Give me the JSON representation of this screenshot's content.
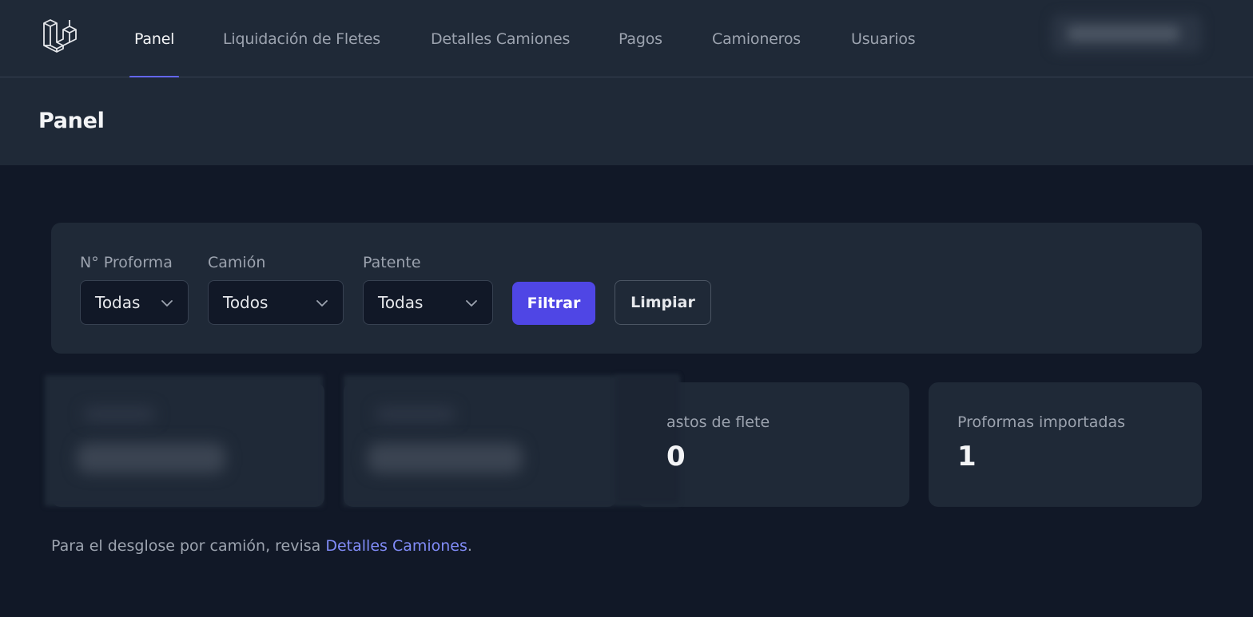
{
  "nav": {
    "items": [
      {
        "label": "Panel",
        "active": true
      },
      {
        "label": "Liquidación de Fletes",
        "active": false
      },
      {
        "label": "Detalles Camiones",
        "active": false
      },
      {
        "label": "Pagos",
        "active": false
      },
      {
        "label": "Camioneros",
        "active": false
      },
      {
        "label": "Usuarios",
        "active": false
      }
    ],
    "logo_icon": "laravel-logo-icon",
    "user_menu_icon": "user-menu-icon"
  },
  "header": {
    "title": "Panel"
  },
  "filters": {
    "proforma": {
      "label": "N° Proforma",
      "value": "Todas"
    },
    "camion": {
      "label": "Camión",
      "value": "Todos"
    },
    "patente": {
      "label": "Patente",
      "value": "Todas"
    },
    "filter_button": "Filtrar",
    "clear_button": "Limpiar"
  },
  "stats": [
    {
      "label": "astos de flete",
      "value": "0"
    },
    {
      "label": "Proformas importadas",
      "value": "1"
    }
  ],
  "footnote": {
    "text": "Para el desglose por camión, revisa ",
    "link": "Detalles Camiones",
    "suffix": "."
  },
  "colors": {
    "background": "#111827",
    "surface": "#1f2937",
    "accent": "#4f46e5",
    "link": "#818cf8"
  }
}
